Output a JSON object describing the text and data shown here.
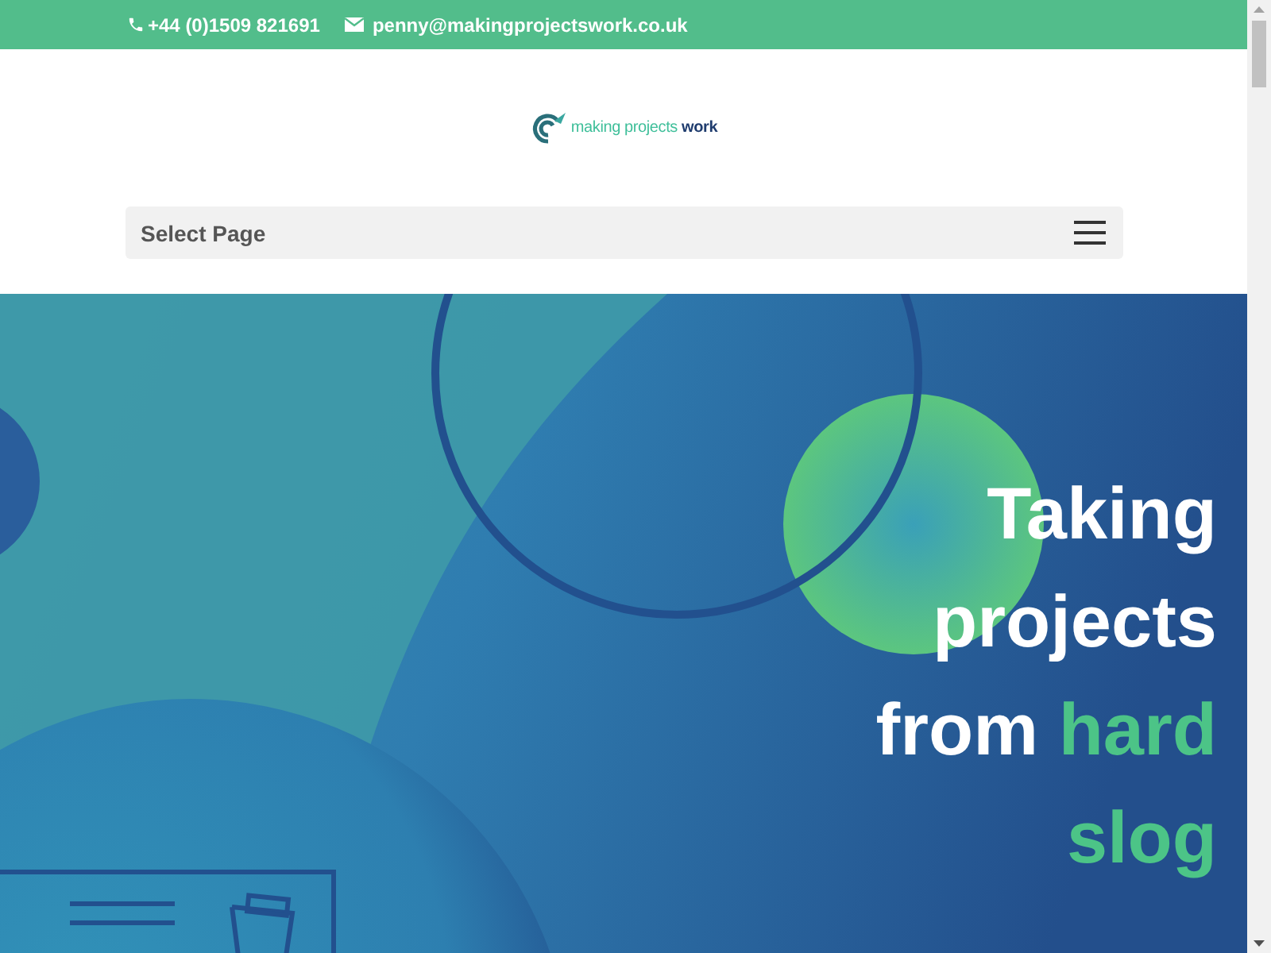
{
  "top_bar": {
    "phone": "+44 (0)1509 821691",
    "email": "penny@makingprojectswork.co.uk"
  },
  "logo": {
    "text": "making projects",
    "bold_text": "work"
  },
  "nav": {
    "label": "Select Page"
  },
  "hero": {
    "heading": [
      {
        "text": "Taking projects from",
        "highlight": false
      },
      {
        "text": "hard slog",
        "highlight": true
      }
    ]
  }
}
